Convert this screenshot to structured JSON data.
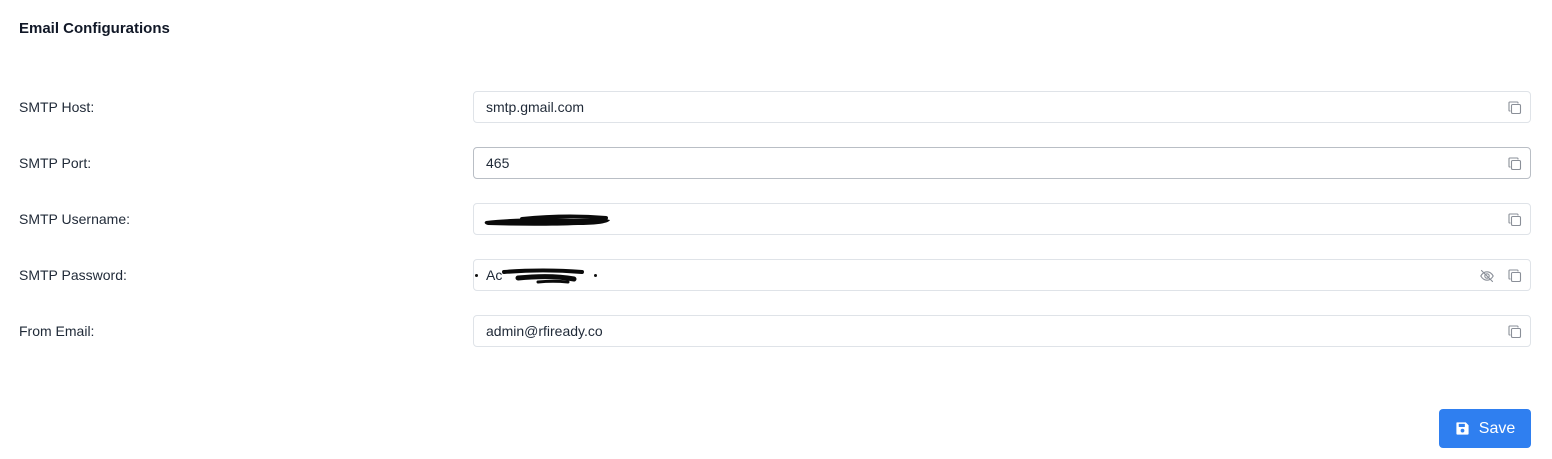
{
  "section": {
    "title": "Email Configurations"
  },
  "fields": {
    "smtp_host": {
      "label": "SMTP Host:",
      "value": "smtp.gmail.com"
    },
    "smtp_port": {
      "label": "SMTP Port:",
      "value": "465"
    },
    "smtp_username": {
      "label": "SMTP Username:",
      "value": ""
    },
    "smtp_password": {
      "label": "SMTP Password:",
      "value": "Ac"
    },
    "from_email": {
      "label": "From Email:",
      "value": "admin@rfiready.co"
    }
  },
  "actions": {
    "save_label": "Save"
  },
  "icons": {
    "copy": "copy-icon",
    "visibility_off": "eye-off-icon",
    "save": "floppy-disk-icon"
  },
  "colors": {
    "primary": "#2f7ff0",
    "border": "#dfe3e8",
    "text": "#1f2937",
    "icon": "#8a8f98"
  }
}
